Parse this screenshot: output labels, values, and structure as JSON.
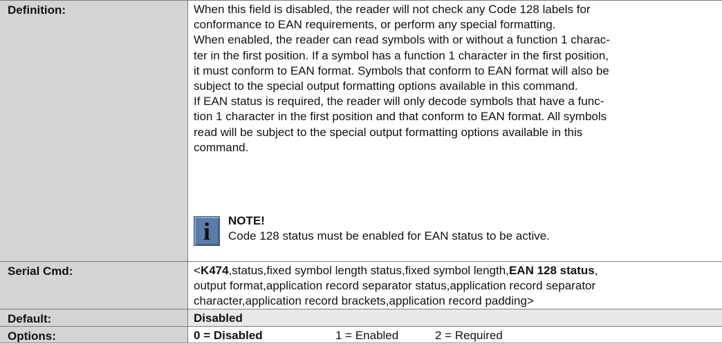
{
  "definition": {
    "label": "Definition:",
    "lines": [
      "When this field is disabled, the reader will not check any Code 128 labels for",
      "conformance to EAN requirements, or perform any special formatting.",
      "When enabled, the reader can read symbols with or without a function 1 charac-",
      "ter in the first position. If a symbol has a function 1 character in the first position,",
      "it must conform to EAN format. Symbols that conform to EAN format will also be",
      "subject to the special output formatting options available in this command.",
      "If EAN status is required, the reader will only decode symbols that have a func-",
      "tion 1 character in the first position and that conform to EAN format. All symbols",
      "read will be subject to the special output formatting options available in this",
      "command."
    ],
    "note_title": "NOTE!",
    "note_text": "Code 128 status must be enabled for EAN status to be active.",
    "note_icon": "info-icon"
  },
  "serial_cmd": {
    "label": "Serial Cmd:",
    "line1_prefix": "<",
    "line1_cmd": "K474",
    "line1_mid": ",status,fixed symbol length status,fixed symbol length,",
    "line1_bold": "EAN 128 status",
    "line1_end": ",",
    "line2": "output format,application record separator status,application record separator",
    "line3": "character,application record brackets,application record padding>"
  },
  "default": {
    "label": "Default:",
    "value": "Disabled"
  },
  "options": {
    "label": "Options:",
    "opt0": "0 = Disabled",
    "opt1": "1 = Enabled",
    "opt2": "2 = Required"
  }
}
